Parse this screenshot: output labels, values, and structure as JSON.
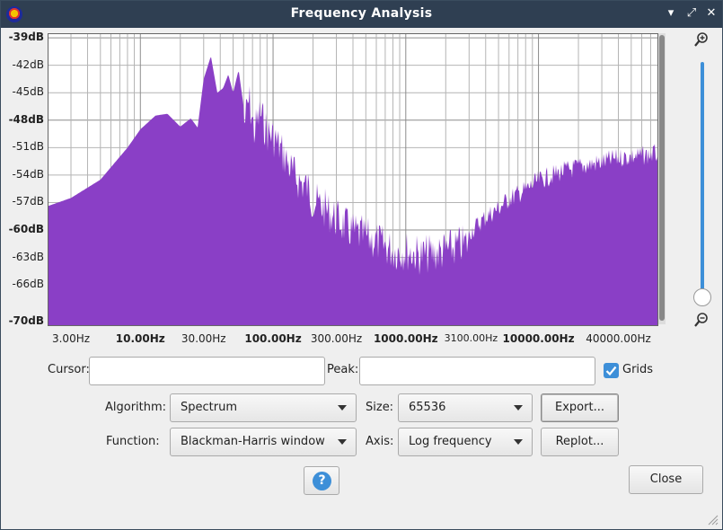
{
  "window": {
    "title": "Frequency Analysis",
    "minimize": "▾",
    "maximize": "⤢",
    "close": "✕"
  },
  "y_axis": {
    "labels": [
      "-39dB",
      "-42dB",
      "-45dB",
      "-48dB",
      "-51dB",
      "-54dB",
      "-57dB",
      "-60dB",
      "-63dB",
      "-66dB",
      "-70dB"
    ],
    "bold": [
      true,
      false,
      false,
      true,
      false,
      false,
      false,
      true,
      false,
      false,
      true
    ]
  },
  "x_axis": {
    "labels": [
      "3.00Hz",
      "10.00Hz",
      "30.00Hz",
      "100.00Hz",
      "300.00Hz",
      "1000.00Hz",
      "3100.00Hz",
      "10000.00Hz",
      "40000.00Hz"
    ],
    "bold": [
      false,
      true,
      false,
      true,
      false,
      true,
      false,
      true,
      false
    ]
  },
  "controls": {
    "cursor_label": "Cursor:",
    "cursor_value": "",
    "peak_label": "Peak:",
    "peak_value": "",
    "grids_label": "Grids",
    "grids_checked": true,
    "algorithm_label": "Algorithm:",
    "algorithm_value": "Spectrum",
    "size_label": "Size:",
    "size_value": "65536",
    "export_label": "Export...",
    "function_label": "Function:",
    "function_value": "Blackman-Harris window",
    "axis_label": "Axis:",
    "axis_value": "Log frequency",
    "replot_label": "Replot...",
    "help_label": "?",
    "close_label": "Close"
  },
  "chart_data": {
    "type": "area",
    "xscale": "log",
    "xlim": [
      2,
      80000
    ],
    "ylim": [
      -70.5,
      -38.5
    ],
    "grid": true,
    "color": "#8a3fc6",
    "x": [
      2,
      3,
      5,
      8,
      10,
      13,
      16,
      20,
      24,
      27,
      30,
      34,
      38,
      42,
      46,
      50,
      55,
      60,
      66,
      72,
      80,
      90,
      100,
      110,
      125,
      140,
      160,
      180,
      200,
      250,
      300,
      400,
      500,
      600,
      700,
      800,
      1000,
      1300,
      1600,
      2000,
      2500,
      3100,
      4000,
      5000,
      6000,
      8000,
      10000,
      15000,
      20000,
      30000,
      40000,
      60000,
      80000
    ],
    "y": [
      -57.4,
      -56.5,
      -54.5,
      -51,
      -49,
      -47.5,
      -47.3,
      -48.7,
      -47.8,
      -48.8,
      -43.5,
      -41,
      -45,
      -44.5,
      -43,
      -45,
      -42.5,
      -46.5,
      -43.5,
      -47,
      -45,
      -47,
      -47.5,
      -48.5,
      -50,
      -51.5,
      -52.5,
      -53,
      -54.5,
      -55.5,
      -56.5,
      -58,
      -58.5,
      -59,
      -59.5,
      -60,
      -60,
      -60.5,
      -60.3,
      -60,
      -59.5,
      -59,
      -57.5,
      -56.5,
      -55.5,
      -54.5,
      -53.5,
      -52.5,
      -52,
      -51.5,
      -51,
      -50.8,
      -50.5
    ]
  }
}
